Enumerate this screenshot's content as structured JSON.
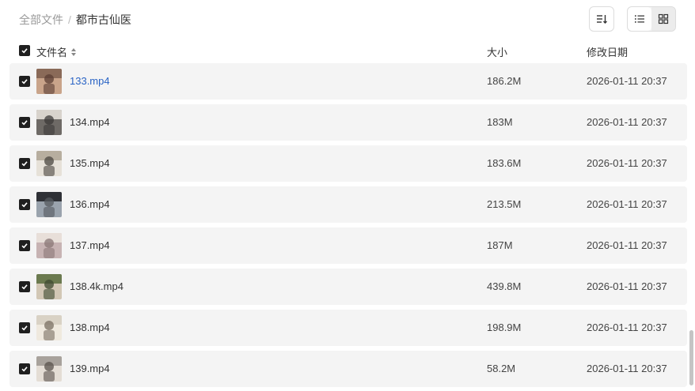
{
  "breadcrumb": {
    "root": "全部文件",
    "separator": "/",
    "current": "都市古仙医"
  },
  "toolbar": {
    "sort_icon": "sort-icon",
    "list_view_icon": "list-view-icon",
    "grid_view_icon": "grid-view-icon"
  },
  "table": {
    "headers": {
      "name": "文件名",
      "size": "大小",
      "modified": "修改日期"
    },
    "rows": [
      {
        "name": "133.mp4",
        "size": "186.2M",
        "date": "2026-01-11 20:37",
        "selected": true,
        "thumb_colors": [
          "#8a6a58",
          "#c9a48a",
          "#5a3e33"
        ]
      },
      {
        "name": "134.mp4",
        "size": "183M",
        "date": "2026-01-11 20:37",
        "selected": true,
        "thumb_colors": [
          "#d8d3cc",
          "#6e6a66",
          "#3c3a38"
        ]
      },
      {
        "name": "135.mp4",
        "size": "183.6M",
        "date": "2026-01-11 20:37",
        "selected": true,
        "thumb_colors": [
          "#b7ae9f",
          "#e6e1d8",
          "#4a4540"
        ]
      },
      {
        "name": "136.mp4",
        "size": "213.5M",
        "date": "2026-01-11 20:37",
        "selected": true,
        "thumb_colors": [
          "#2f3136",
          "#9aa3ad",
          "#55595f"
        ]
      },
      {
        "name": "137.mp4",
        "size": "187M",
        "date": "2026-01-11 20:37",
        "selected": true,
        "thumb_colors": [
          "#e8dfd9",
          "#c7b3b3",
          "#8a7776"
        ]
      },
      {
        "name": "138.4k.mp4",
        "size": "439.8M",
        "date": "2026-01-11 20:37",
        "selected": true,
        "thumb_colors": [
          "#6b7a4f",
          "#d2c7b5",
          "#3d4a30"
        ]
      },
      {
        "name": "138.mp4",
        "size": "198.9M",
        "date": "2026-01-11 20:37",
        "selected": true,
        "thumb_colors": [
          "#d9d2c5",
          "#efe9de",
          "#7a6f62"
        ]
      },
      {
        "name": "139.mp4",
        "size": "58.2M",
        "date": "2026-01-11 20:37",
        "selected": true,
        "thumb_colors": [
          "#a8a29c",
          "#e4ddd5",
          "#5a524c"
        ]
      }
    ]
  },
  "colors": {
    "link": "#2a64c5",
    "row_bg": "#f4f4f4",
    "checkbox": "#1f1f1f"
  }
}
